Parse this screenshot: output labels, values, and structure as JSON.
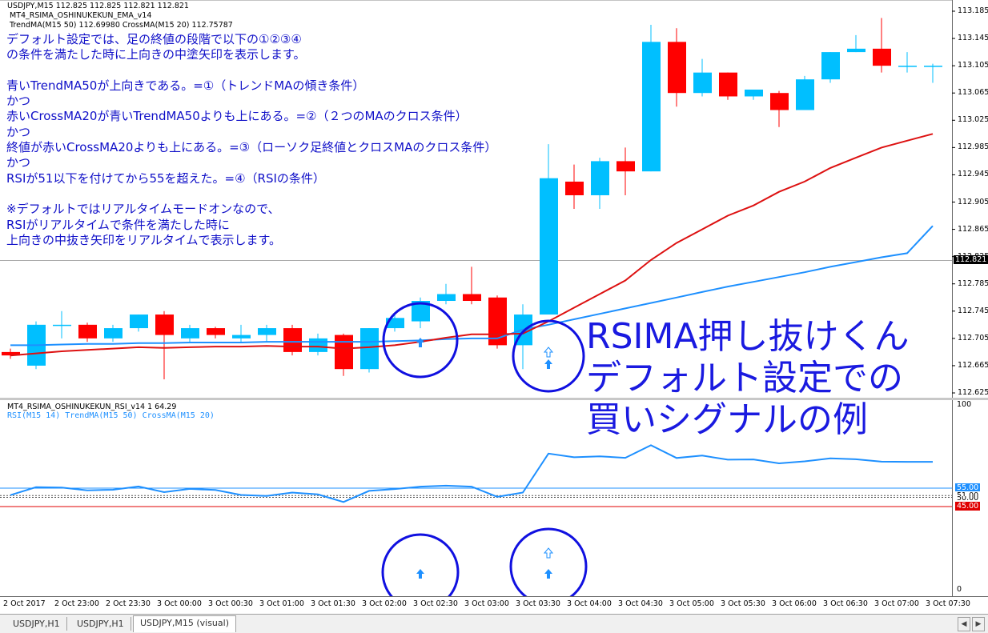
{
  "main_chart": {
    "header_line1": "USDJPY,M15  112.825 112.825 112.821 112.821",
    "header_line2": "MT4_RSIMA_OSHINUKEKUN_EMA_v14",
    "header_line3": "TrendMA(M15 50) 112.69980 CrossMA(M15 20) 112.75787",
    "annotation_lines": [
      "デフォルト設定では、足の終値の段階で以下の①②③④",
      "の条件を満たした時に上向きの中塗矢印を表示します。",
      "",
      "青いTrendMA50が上向きである。=①（トレンドMAの傾き条件）",
      "かつ",
      "赤いCrossMA20が青いTrendMA50よりも上にある。=②（２つのMAのクロス条件）",
      "かつ",
      "終値が赤いCrossMA20よりも上にある。=③（ローソク足終値とクロスMAのクロス条件）",
      "かつ",
      "RSIが51以下を付けてから55を超えた。=④（RSIの条件）",
      "",
      "※デフォルトではリアルタイムモードオンなので、",
      "RSIがリアルタイムで条件を満たした時に",
      "上向きの中抜き矢印をリアルタイムで表示します。"
    ],
    "title_lines": [
      "RSIMA押し抜けくん",
      "デフォルト設定での",
      "買いシグナルの例"
    ],
    "price_labels": [
      "113.185",
      "113.145",
      "113.105",
      "113.065",
      "113.025",
      "112.985",
      "112.945",
      "112.905",
      "112.865",
      "112.825",
      "112.785",
      "112.745",
      "112.705",
      "112.665",
      "112.625"
    ],
    "current_price": "112.821"
  },
  "rsi_panel": {
    "header_line1": "MT4_RSIMA_OSHINUKEKUN_RSI_v14 1 64.29",
    "header_line2": "RSI(M15 14) TrendMA(M15 50) CrossMA(M15 20)",
    "level_labels": {
      "top": "100",
      "l55": "55.00",
      "l51": "51.00",
      "l50": "50.00",
      "l45": "45.00",
      "bottom": "0"
    }
  },
  "time_labels": [
    "2 Oct 2017",
    "2 Oct 23:00",
    "2 Oct 23:30",
    "3 Oct 00:00",
    "3 Oct 00:30",
    "3 Oct 01:00",
    "3 Oct 01:30",
    "3 Oct 02:00",
    "3 Oct 02:30",
    "3 Oct 03:00",
    "3 Oct 03:30",
    "3 Oct 04:00",
    "3 Oct 04:30",
    "3 Oct 05:00",
    "3 Oct 05:30",
    "3 Oct 06:00",
    "3 Oct 06:30",
    "3 Oct 07:00",
    "3 Oct 07:30"
  ],
  "tabs": [
    "USDJPY,H1",
    "USDJPY,H1",
    "USDJPY,M15 (visual)"
  ],
  "chart_data": {
    "type": "candlestick",
    "colors": {
      "bull": "#00bfff",
      "bear": "#ff0000",
      "trend_ma": "#1e90ff",
      "cross_ma": "#dd1111",
      "rsi": "#1e90ff"
    },
    "candles": [
      [
        112.685,
        112.69,
        112.675,
        112.68
      ],
      [
        112.665,
        112.73,
        112.66,
        112.725
      ],
      [
        112.725,
        112.745,
        112.705,
        112.725
      ],
      [
        112.725,
        112.728,
        112.7,
        112.705
      ],
      [
        112.705,
        112.725,
        112.7,
        112.72
      ],
      [
        112.72,
        112.74,
        112.715,
        112.74
      ],
      [
        112.74,
        112.745,
        112.645,
        112.71
      ],
      [
        112.705,
        112.725,
        112.7,
        112.72
      ],
      [
        112.72,
        112.722,
        112.705,
        112.71
      ],
      [
        112.705,
        112.725,
        112.7,
        112.71
      ],
      [
        112.71,
        112.725,
        112.7,
        112.72
      ],
      [
        112.72,
        112.725,
        112.68,
        112.685
      ],
      [
        112.685,
        112.712,
        112.68,
        112.705
      ],
      [
        112.71,
        112.712,
        112.65,
        112.66
      ],
      [
        112.66,
        112.72,
        112.655,
        112.72
      ],
      [
        112.72,
        112.74,
        112.715,
        112.735
      ],
      [
        112.73,
        112.765,
        112.72,
        112.76
      ],
      [
        112.76,
        112.785,
        112.755,
        112.77
      ],
      [
        112.77,
        112.81,
        112.755,
        112.76
      ],
      [
        112.765,
        112.768,
        112.69,
        112.695
      ],
      [
        112.695,
        112.755,
        112.66,
        112.74
      ],
      [
        112.74,
        112.99,
        112.74,
        112.94
      ],
      [
        112.935,
        112.96,
        112.895,
        112.915
      ],
      [
        112.915,
        112.97,
        112.895,
        112.965
      ],
      [
        112.965,
        112.985,
        112.915,
        112.95
      ],
      [
        112.95,
        113.165,
        112.95,
        113.14
      ],
      [
        113.14,
        113.16,
        113.045,
        113.065
      ],
      [
        113.065,
        113.115,
        113.06,
        113.095
      ],
      [
        113.095,
        113.095,
        113.055,
        113.06
      ],
      [
        113.06,
        113.07,
        113.055,
        113.07
      ],
      [
        113.065,
        113.068,
        113.015,
        113.04
      ],
      [
        113.04,
        113.09,
        113.04,
        113.085
      ],
      [
        113.085,
        113.125,
        113.08,
        113.125
      ],
      [
        113.125,
        113.15,
        113.125,
        113.13
      ],
      [
        113.13,
        113.175,
        113.095,
        113.105
      ],
      [
        113.105,
        113.125,
        113.095,
        113.105
      ],
      [
        113.105,
        113.108,
        113.08,
        113.105
      ]
    ],
    "trend_ma": [
      112.695,
      112.695,
      112.696,
      112.697,
      112.697,
      112.698,
      112.698,
      112.699,
      112.699,
      112.699,
      112.7,
      112.7,
      112.7,
      112.7,
      112.7,
      112.701,
      112.702,
      112.704,
      112.705,
      112.705,
      112.718,
      112.725,
      112.733,
      112.741,
      112.749,
      112.757,
      112.765,
      112.773,
      112.781,
      112.788,
      112.795,
      112.802,
      112.81,
      112.817,
      112.824,
      112.83,
      112.87
    ],
    "cross_ma": [
      112.68,
      112.683,
      112.686,
      112.688,
      112.69,
      112.692,
      112.691,
      112.692,
      112.693,
      112.693,
      112.694,
      112.693,
      112.693,
      112.69,
      112.692,
      112.695,
      112.7,
      112.706,
      112.711,
      112.711,
      112.712,
      112.73,
      112.75,
      112.77,
      112.79,
      112.82,
      112.845,
      112.865,
      112.885,
      112.9,
      112.92,
      112.935,
      112.955,
      112.97,
      112.985,
      112.995,
      113.005
    ],
    "rsi": [
      51.2,
      55.5,
      55.3,
      53.8,
      54.1,
      55.9,
      52.8,
      54.6,
      54.0,
      51.3,
      50.8,
      52.6,
      51.6,
      47.5,
      53.5,
      54.5,
      55.8,
      56.3,
      55.8,
      50.3,
      52.6,
      73.7,
      71.7,
      72.2,
      71.4,
      78.2,
      71.3,
      72.6,
      70.4,
      70.5,
      68.4,
      69.5,
      71.1,
      70.6,
      69.3,
      69.2,
      69.2
    ],
    "buy_arrows": [
      16,
      21
    ],
    "price_range": [
      112.605,
      113.205
    ],
    "rsi_range": [
      0,
      100
    ]
  }
}
